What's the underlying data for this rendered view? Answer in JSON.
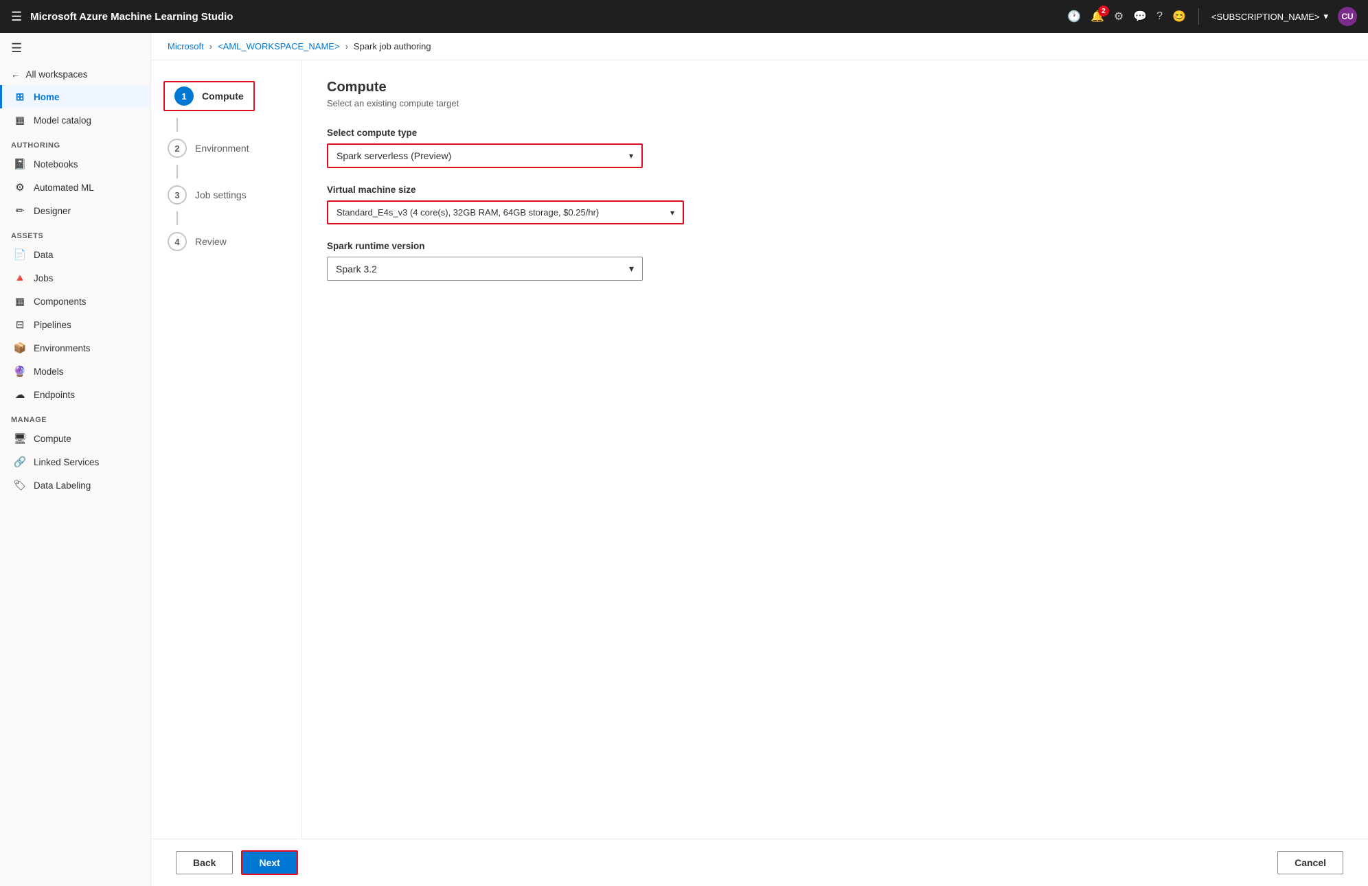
{
  "app": {
    "title": "Microsoft Azure Machine Learning Studio"
  },
  "topnav": {
    "history_icon": "🕐",
    "notifications_icon": "🔔",
    "notification_count": "2",
    "settings_icon": "⚙",
    "feedback_icon": "💬",
    "help_icon": "?",
    "user_icon": "😊",
    "subscription_name": "<SUBSCRIPTION_NAME>",
    "avatar_text": "CU"
  },
  "breadcrumb": {
    "items": [
      {
        "label": "Microsoft",
        "link": true
      },
      {
        "label": "<AML_WORKSPACE_NAME>",
        "link": true
      },
      {
        "label": "Spark job authoring",
        "link": false
      }
    ]
  },
  "sidebar": {
    "back_label": "All workspaces",
    "nav_items": [
      {
        "id": "home",
        "label": "Home",
        "icon": "⊞",
        "active": true
      },
      {
        "id": "model-catalog",
        "label": "Model catalog",
        "icon": "▦"
      }
    ],
    "authoring_label": "Authoring",
    "authoring_items": [
      {
        "id": "notebooks",
        "label": "Notebooks",
        "icon": "📓"
      },
      {
        "id": "automated-ml",
        "label": "Automated ML",
        "icon": "⚙"
      },
      {
        "id": "designer",
        "label": "Designer",
        "icon": "✏"
      }
    ],
    "assets_label": "Assets",
    "assets_items": [
      {
        "id": "data",
        "label": "Data",
        "icon": "📄"
      },
      {
        "id": "jobs",
        "label": "Jobs",
        "icon": "🔺"
      },
      {
        "id": "components",
        "label": "Components",
        "icon": "▦"
      },
      {
        "id": "pipelines",
        "label": "Pipelines",
        "icon": "⊟"
      },
      {
        "id": "environments",
        "label": "Environments",
        "icon": "📦"
      },
      {
        "id": "models",
        "label": "Models",
        "icon": "🔮"
      },
      {
        "id": "endpoints",
        "label": "Endpoints",
        "icon": "☁"
      }
    ],
    "manage_label": "Manage",
    "manage_items": [
      {
        "id": "compute",
        "label": "Compute",
        "icon": "🖥"
      },
      {
        "id": "linked-services",
        "label": "Linked Services",
        "icon": "🔗"
      },
      {
        "id": "data-labeling",
        "label": "Data Labeling",
        "icon": "🏷"
      }
    ]
  },
  "wizard": {
    "steps": [
      {
        "number": "1",
        "label": "Compute",
        "active": true
      },
      {
        "number": "2",
        "label": "Environment",
        "active": false
      },
      {
        "number": "3",
        "label": "Job settings",
        "active": false
      },
      {
        "number": "4",
        "label": "Review",
        "active": false
      }
    ]
  },
  "content": {
    "title": "Compute",
    "subtitle": "Select an existing compute target",
    "compute_type_label": "Select compute type",
    "compute_type_value": "Spark serverless (Preview)",
    "vm_size_label": "Virtual machine size",
    "vm_size_value": "Standard_E4s_v3 (4 core(s), 32GB RAM, 64GB storage, $0.25/hr)",
    "spark_version_label": "Spark runtime version",
    "spark_version_value": "Spark 3.2"
  },
  "actions": {
    "back_label": "Back",
    "next_label": "Next",
    "cancel_label": "Cancel"
  }
}
